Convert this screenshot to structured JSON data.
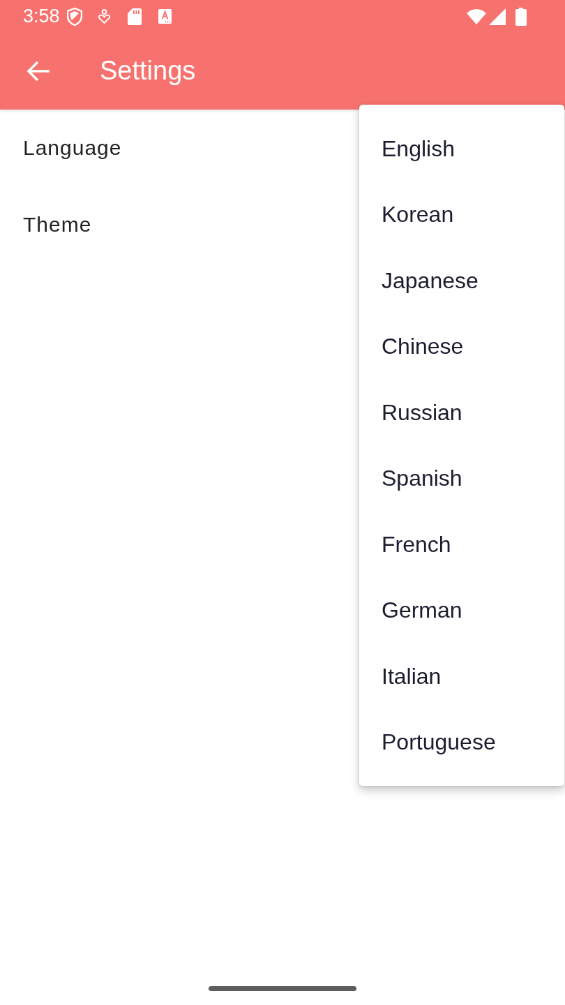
{
  "status_bar": {
    "time": "3:58"
  },
  "app_bar": {
    "title": "Settings"
  },
  "settings": [
    {
      "label": "Language"
    },
    {
      "label": "Theme"
    }
  ],
  "dropdown": {
    "items": [
      {
        "label": "English"
      },
      {
        "label": "Korean"
      },
      {
        "label": "Japanese"
      },
      {
        "label": "Chinese"
      },
      {
        "label": "Russian"
      },
      {
        "label": "Spanish"
      },
      {
        "label": "French"
      },
      {
        "label": "German"
      },
      {
        "label": "Italian"
      },
      {
        "label": "Portuguese"
      }
    ]
  }
}
